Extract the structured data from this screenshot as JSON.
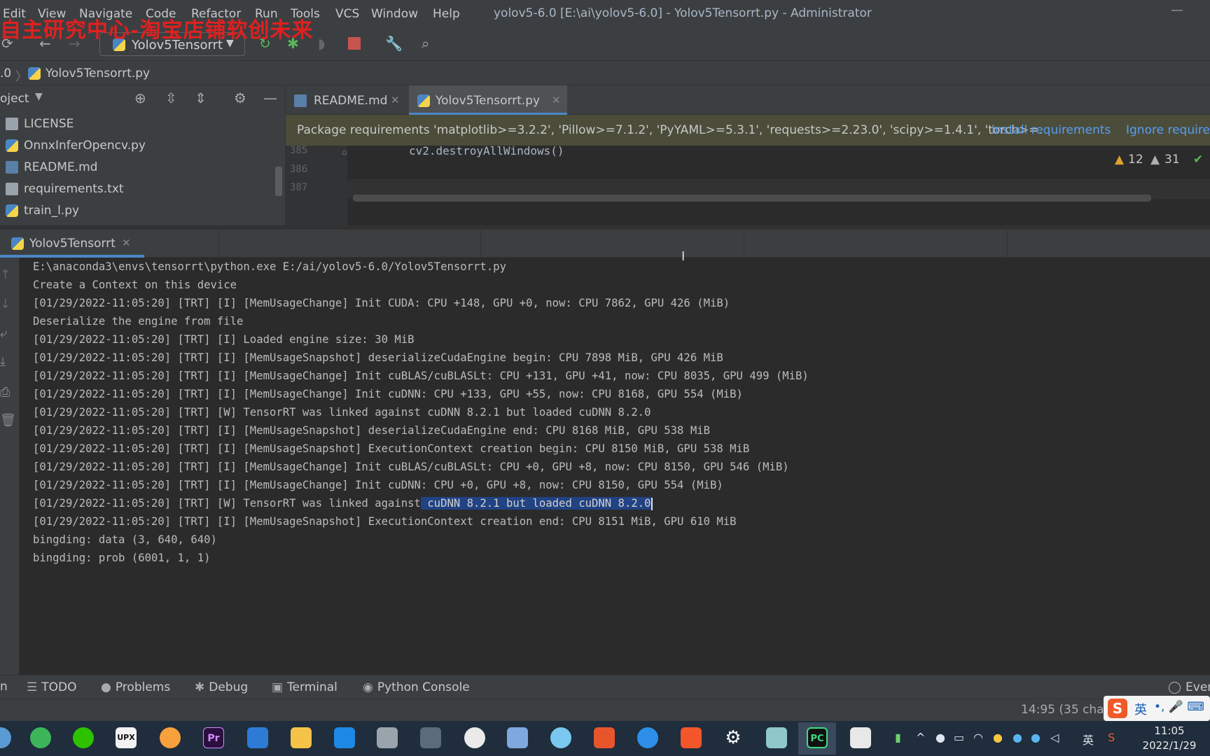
{
  "window": {
    "title": "yolov5-6.0 [E:\\ai\\yolov5-6.0] - Yolov5Tensorrt.py - Administrator",
    "minimize": "—"
  },
  "watermark": "自主研究中心-淘宝店铺软创未来",
  "menu": [
    "Edit",
    "View",
    "Navigate",
    "Code",
    "Refactor",
    "Run",
    "Tools",
    "VCS",
    "Window",
    "Help"
  ],
  "toolbar": {
    "run_config": "Yolov5Tensorrt"
  },
  "breadcrumb": {
    "root": ".0",
    "file": "Yolov5Tensorrt.py"
  },
  "project": {
    "title": "oject",
    "files": [
      "LICENSE",
      "OnnxInferOpencv.py",
      "README.md",
      "requirements.txt",
      "train_l.py"
    ]
  },
  "editor_tabs": [
    {
      "label": "README.md",
      "active": false
    },
    {
      "label": "Yolov5Tensorrt.py",
      "active": true
    }
  ],
  "banner": {
    "text": "Package requirements 'matplotlib>=3.2.2', 'Pillow>=7.1.2', 'PyYAML>=5.3.1', 'requests>=2.23.0', 'scipy>=1.4.1', 'torch>=.",
    "install": "Install requirements",
    "ignore": "Ignore requirem"
  },
  "editor": {
    "lines": [
      {
        "num": "385",
        "code": "cv2.destroyAllWindows()"
      },
      {
        "num": "386",
        "code": ""
      },
      {
        "num": "387",
        "code": ""
      }
    ],
    "warnings_yellow": "12",
    "warnings_grey": "31"
  },
  "run_panel": {
    "tab_label": "Yolov5Tensorrt",
    "lines": [
      "E:\\anaconda3\\envs\\tensorrt\\python.exe E:/ai/yolov5-6.0/Yolov5Tensorrt.py",
      "Create a Context on this device",
      "[01/29/2022-11:05:20] [TRT] [I] [MemUsageChange] Init CUDA: CPU +148, GPU +0, now: CPU 7862, GPU 426 (MiB)",
      "Deserialize the engine from file",
      "[01/29/2022-11:05:20] [TRT] [I] Loaded engine size: 30 MiB",
      "[01/29/2022-11:05:20] [TRT] [I] [MemUsageSnapshot] deserializeCudaEngine begin: CPU 7898 MiB, GPU 426 MiB",
      "[01/29/2022-11:05:20] [TRT] [I] [MemUsageChange] Init cuBLAS/cuBLASLt: CPU +131, GPU +41, now: CPU 8035, GPU 499 (MiB)",
      "[01/29/2022-11:05:20] [TRT] [I] [MemUsageChange] Init cuDNN: CPU +133, GPU +55, now: CPU 8168, GPU 554 (MiB)",
      "[01/29/2022-11:05:20] [TRT] [W] TensorRT was linked against cuDNN 8.2.1 but loaded cuDNN 8.2.0",
      "[01/29/2022-11:05:20] [TRT] [I] [MemUsageSnapshot] deserializeCudaEngine end: CPU 8168 MiB, GPU 538 MiB",
      "[01/29/2022-11:05:20] [TRT] [I] [MemUsageSnapshot] ExecutionContext creation begin: CPU 8150 MiB, GPU 538 MiB",
      "[01/29/2022-11:05:20] [TRT] [I] [MemUsageChange] Init cuBLAS/cuBLASLt: CPU +0, GPU +8, now: CPU 8150, GPU 546 (MiB)",
      "[01/29/2022-11:05:20] [TRT] [I] [MemUsageChange] Init cuDNN: CPU +0, GPU +8, now: CPU 8150, GPU 554 (MiB)",
      "",
      "[01/29/2022-11:05:20] [TRT] [I] [MemUsageSnapshot] ExecutionContext creation end: CPU 8151 MiB, GPU 610 MiB",
      "bingding: data (3, 640, 640)",
      "bingding: prob (6001, 1, 1)"
    ],
    "selected_line": {
      "prefix": "[01/29/2022-11:05:20] [TRT] [W] TensorRT was linked against",
      "selected": " cuDNN 8.2.1 but loaded cuDNN 8.2.0"
    }
  },
  "bottom_tools": [
    "TODO",
    "Problems",
    "Debug",
    "Terminal",
    "Python Console"
  ],
  "bottom_right": "Even",
  "status": {
    "position": "14:95 (35 chars"
  },
  "ime": {
    "logo": "S",
    "lang": "英",
    "rest": "•, 🎤 ⌨"
  },
  "taskbar": {
    "upx_label": "UPX",
    "pr_label": "Pr",
    "pc_label": "PC",
    "tray_lang": "英",
    "time": "11:05",
    "date": "2022/1/29"
  },
  "colors": {
    "accent": "#4a88c7",
    "selection": "#214283",
    "link": "#589df6",
    "watermark": "#e02020"
  }
}
